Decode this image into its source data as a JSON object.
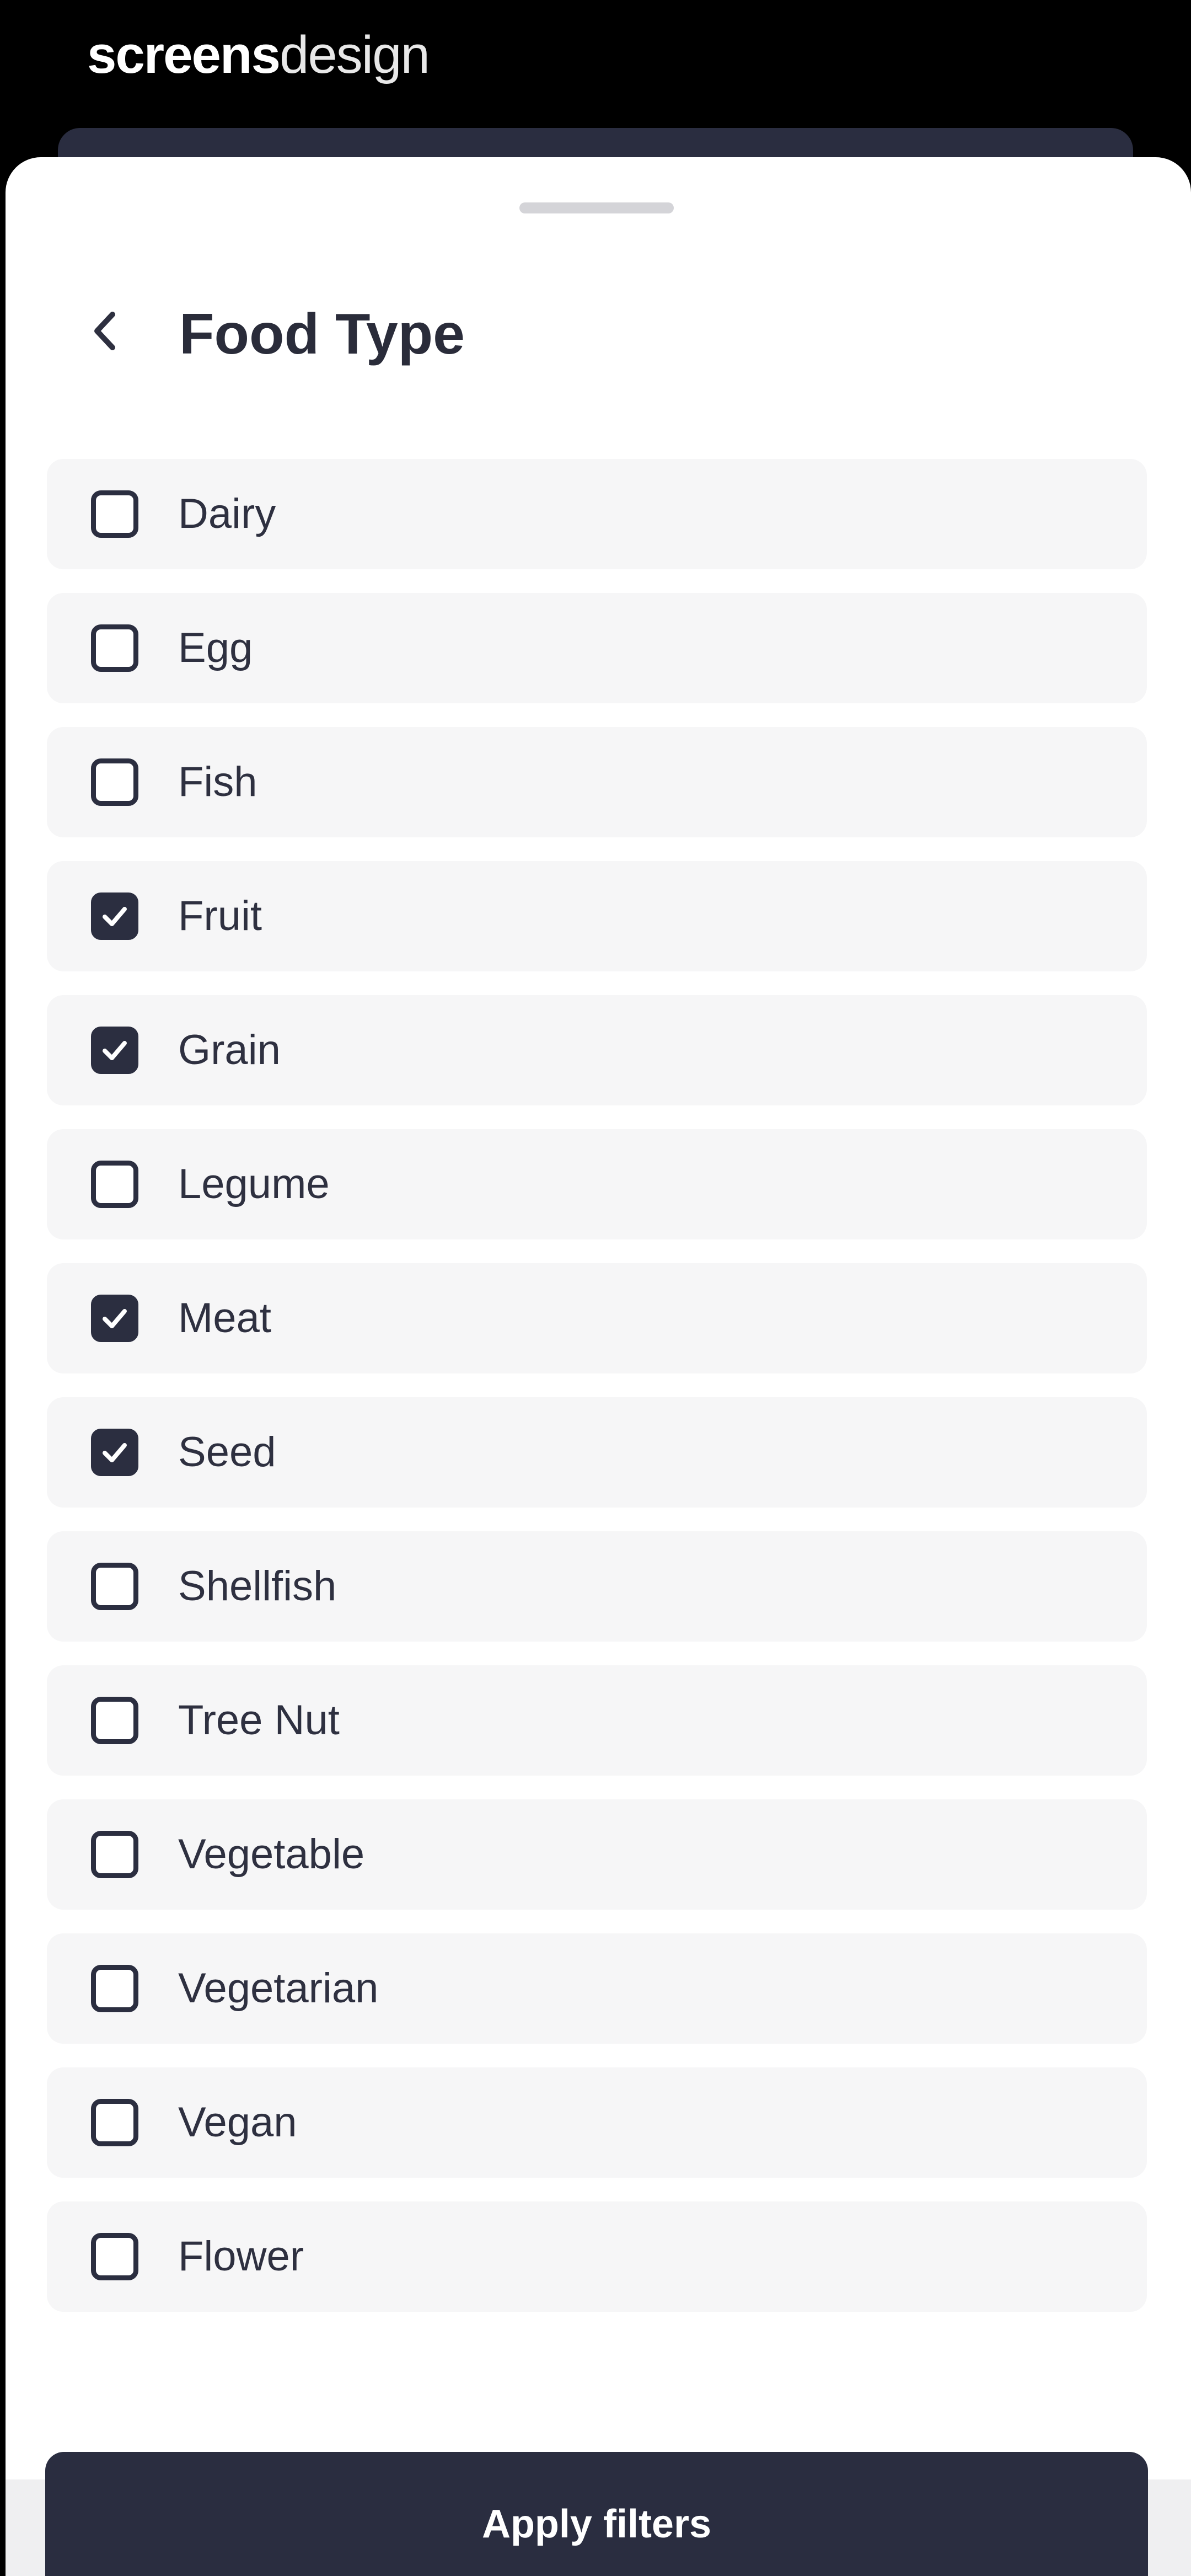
{
  "watermark": {
    "bold": "screens",
    "light": "design"
  },
  "sheet": {
    "title": "Food Type",
    "back_icon": "chevron-left-icon"
  },
  "colors": {
    "primary": "#2a2d40",
    "item_background": "#f6f6f7",
    "text": "#2e3040",
    "screen_background": "#000000"
  },
  "filters": [
    {
      "label": "Dairy",
      "checked": false
    },
    {
      "label": "Egg",
      "checked": false
    },
    {
      "label": "Fish",
      "checked": false
    },
    {
      "label": "Fruit",
      "checked": true
    },
    {
      "label": "Grain",
      "checked": true
    },
    {
      "label": "Legume",
      "checked": false
    },
    {
      "label": "Meat",
      "checked": true
    },
    {
      "label": "Seed",
      "checked": true
    },
    {
      "label": "Shellfish",
      "checked": false
    },
    {
      "label": "Tree Nut",
      "checked": false
    },
    {
      "label": "Vegetable",
      "checked": false
    },
    {
      "label": "Vegetarian",
      "checked": false
    },
    {
      "label": "Vegan",
      "checked": false
    },
    {
      "label": "Flower",
      "checked": false
    }
  ],
  "apply_button": {
    "label": "Apply filters"
  }
}
